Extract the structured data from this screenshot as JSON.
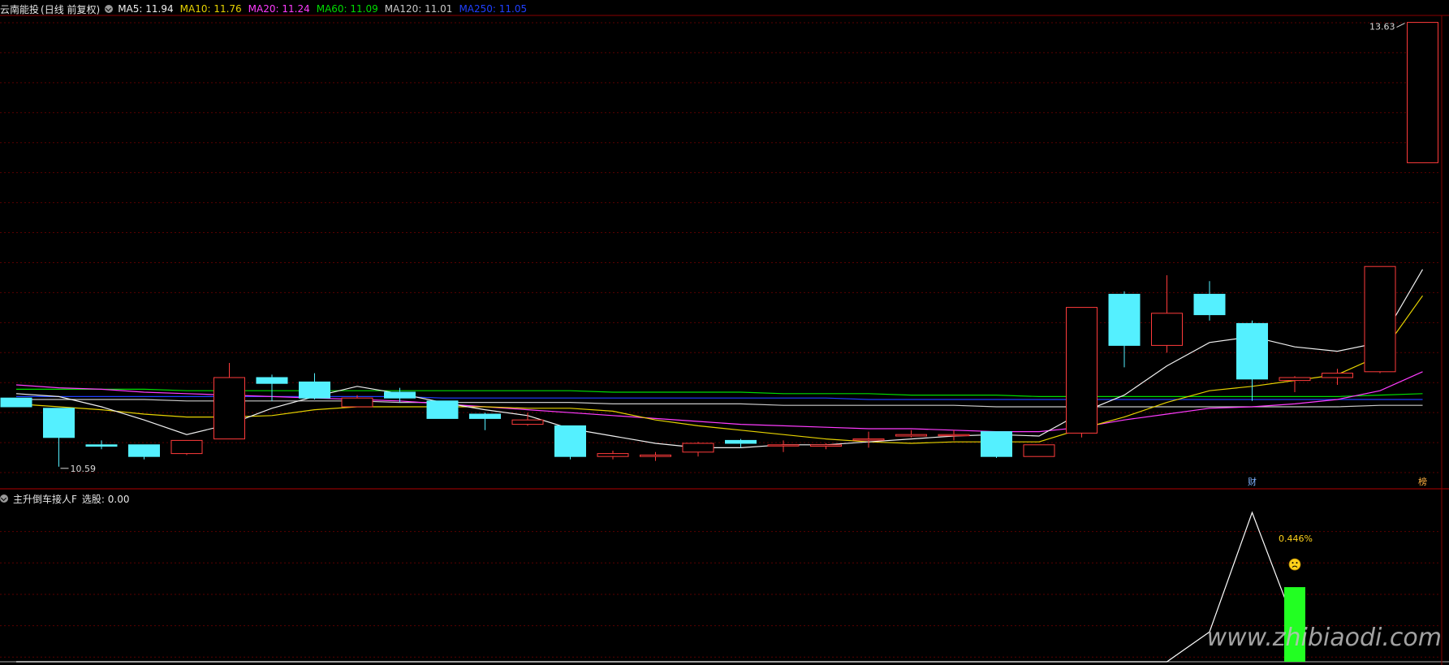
{
  "main_panel": {
    "stock_name": "云南能投",
    "mode_label": "(日线 前复权)",
    "indicators": [
      {
        "label": "MA5: 11.94",
        "color": "#f0f0f0"
      },
      {
        "label": "MA10: 11.76",
        "color": "#e6d200"
      },
      {
        "label": "MA20: 11.24",
        "color": "#ff3cff"
      },
      {
        "label": "MA60: 11.09",
        "color": "#00dc00"
      },
      {
        "label": "MA120: 11.01",
        "color": "#c8c8c8"
      },
      {
        "label": "MA250: 11.05",
        "color": "#2040ff"
      }
    ],
    "high_label": "13.63",
    "low_label": "10.59",
    "event_marker_1": "财",
    "event_marker_2": "榜"
  },
  "sub_panel": {
    "indicator_name": "主升倒车接人F",
    "value_label": "选股: 0.00",
    "percent_label": "0.446%",
    "emoji_icon": "sad-face-icon"
  },
  "watermark": "www.zhibiaodi.com",
  "colors": {
    "up": "#ff3b3b",
    "down": "#54f0ff",
    "grid": "#5a0000",
    "ma5": "#f0f0f0",
    "ma10": "#e6d200",
    "ma20": "#ff3cff",
    "ma60": "#00dc00",
    "ma120": "#c8c8c8",
    "ma250": "#2040ff",
    "signal_bar": "#22ff22"
  },
  "chart_data": {
    "type": "candlestick",
    "candles": [
      {
        "o": 11.06,
        "c": 11.0,
        "h": 11.06,
        "l": 11.0
      },
      {
        "o": 10.99,
        "c": 10.79,
        "h": 10.99,
        "l": 10.59
      },
      {
        "o": 10.74,
        "c": 10.73,
        "h": 10.77,
        "l": 10.71
      },
      {
        "o": 10.74,
        "c": 10.66,
        "h": 10.74,
        "l": 10.64
      },
      {
        "o": 10.68,
        "c": 10.77,
        "h": 10.77,
        "l": 10.67
      },
      {
        "o": 10.78,
        "c": 11.2,
        "h": 11.3,
        "l": 10.78
      },
      {
        "o": 11.2,
        "c": 11.16,
        "h": 11.22,
        "l": 11.04
      },
      {
        "o": 11.17,
        "c": 11.06,
        "h": 11.23,
        "l": 11.05
      },
      {
        "o": 11.0,
        "c": 11.06,
        "h": 11.08,
        "l": 11.0
      },
      {
        "o": 11.1,
        "c": 11.06,
        "h": 11.13,
        "l": 11.03
      },
      {
        "o": 11.04,
        "c": 10.92,
        "h": 11.04,
        "l": 10.92
      },
      {
        "o": 10.95,
        "c": 10.92,
        "h": 10.96,
        "l": 10.84
      },
      {
        "o": 10.88,
        "c": 10.91,
        "h": 10.96,
        "l": 10.87
      },
      {
        "o": 10.87,
        "c": 10.66,
        "h": 10.87,
        "l": 10.64
      },
      {
        "o": 10.66,
        "c": 10.68,
        "h": 10.7,
        "l": 10.64
      },
      {
        "o": 10.66,
        "c": 10.67,
        "h": 10.69,
        "l": 10.63
      },
      {
        "o": 10.69,
        "c": 10.75,
        "h": 10.76,
        "l": 10.66
      },
      {
        "o": 10.77,
        "c": 10.75,
        "h": 10.78,
        "l": 10.72
      },
      {
        "o": 10.74,
        "c": 10.74,
        "h": 10.77,
        "l": 10.69
      },
      {
        "o": 10.73,
        "c": 10.74,
        "h": 10.75,
        "l": 10.71
      },
      {
        "o": 10.78,
        "c": 10.78,
        "h": 10.83,
        "l": 10.72
      },
      {
        "o": 10.8,
        "c": 10.81,
        "h": 10.84,
        "l": 10.79
      },
      {
        "o": 10.81,
        "c": 10.81,
        "h": 10.84,
        "l": 10.77
      },
      {
        "o": 10.83,
        "c": 10.66,
        "h": 10.83,
        "l": 10.65
      },
      {
        "o": 10.66,
        "c": 10.74,
        "h": 10.74,
        "l": 10.66
      },
      {
        "o": 10.82,
        "c": 11.68,
        "h": 11.68,
        "l": 10.79
      },
      {
        "o": 11.77,
        "c": 11.42,
        "h": 11.79,
        "l": 11.27
      },
      {
        "o": 11.42,
        "c": 11.64,
        "h": 11.9,
        "l": 11.37
      },
      {
        "o": 11.77,
        "c": 11.63,
        "h": 11.86,
        "l": 11.59
      },
      {
        "o": 11.57,
        "c": 11.19,
        "h": 11.59,
        "l": 11.04
      },
      {
        "o": 11.18,
        "c": 11.2,
        "h": 11.21,
        "l": 11.1
      },
      {
        "o": 11.2,
        "c": 11.23,
        "h": 11.26,
        "l": 11.15
      },
      {
        "o": 11.24,
        "c": 11.96,
        "h": 11.96,
        "l": 11.23
      },
      {
        "o": 12.67,
        "c": 13.63,
        "h": 13.63,
        "l": 12.67
      }
    ],
    "ma5": [
      11.09,
      11.07,
      11.0,
      10.91,
      10.81,
      10.88,
      10.99,
      11.07,
      11.14,
      11.09,
      11.03,
      10.98,
      10.94,
      10.85,
      10.8,
      10.75,
      10.72,
      10.72,
      10.74,
      10.74,
      10.76,
      10.78,
      10.8,
      10.81,
      10.8,
      10.96,
      11.08,
      11.28,
      11.44,
      11.48,
      11.41,
      11.38,
      11.44,
      11.94
    ],
    "ma10": [
      11.02,
      11.0,
      10.98,
      10.95,
      10.93,
      10.93,
      10.94,
      10.98,
      11.0,
      11.0,
      11.0,
      11.0,
      10.99,
      10.99,
      10.97,
      10.91,
      10.87,
      10.84,
      10.81,
      10.78,
      10.76,
      10.75,
      10.76,
      10.76,
      10.76,
      10.85,
      10.93,
      11.03,
      11.11,
      11.14,
      11.18,
      11.22,
      11.35,
      11.76
    ],
    "ma20": [
      11.15,
      11.13,
      11.12,
      11.1,
      11.09,
      11.08,
      11.07,
      11.06,
      11.05,
      11.04,
      11.02,
      11.0,
      10.98,
      10.96,
      10.94,
      10.92,
      10.9,
      10.88,
      10.87,
      10.86,
      10.85,
      10.85,
      10.84,
      10.83,
      10.83,
      10.86,
      10.91,
      10.95,
      10.99,
      11.0,
      11.02,
      11.05,
      11.11,
      11.24
    ],
    "ma60": [
      11.12,
      11.12,
      11.12,
      11.12,
      11.11,
      11.11,
      11.11,
      11.11,
      11.11,
      11.11,
      11.11,
      11.11,
      11.11,
      11.11,
      11.1,
      11.1,
      11.1,
      11.1,
      11.09,
      11.09,
      11.09,
      11.08,
      11.08,
      11.08,
      11.07,
      11.07,
      11.07,
      11.07,
      11.07,
      11.07,
      11.07,
      11.07,
      11.08,
      11.09
    ],
    "ma120": [
      11.05,
      11.05,
      11.05,
      11.05,
      11.04,
      11.04,
      11.04,
      11.04,
      11.04,
      11.03,
      11.03,
      11.03,
      11.03,
      11.03,
      11.02,
      11.02,
      11.02,
      11.02,
      11.01,
      11.01,
      11.01,
      11.01,
      11.01,
      11.0,
      11.0,
      11.0,
      11.0,
      11.0,
      11.0,
      11.0,
      11.0,
      11.0,
      11.01,
      11.01
    ],
    "ma250": [
      11.07,
      11.07,
      11.07,
      11.07,
      11.07,
      11.07,
      11.07,
      11.07,
      11.07,
      11.07,
      11.06,
      11.06,
      11.06,
      11.06,
      11.06,
      11.06,
      11.06,
      11.06,
      11.06,
      11.06,
      11.05,
      11.05,
      11.05,
      11.05,
      11.05,
      11.05,
      11.05,
      11.05,
      11.05,
      11.05,
      11.05,
      11.05,
      11.05,
      11.05
    ],
    "ylim": [
      10.55,
      13.65
    ],
    "grid_lines": 15,
    "event_bars": [
      29,
      33
    ],
    "sub_indicator": {
      "zigzag": [
        {
          "bar": 0,
          "v": 0
        },
        {
          "bar": 27,
          "v": 0
        },
        {
          "bar": 28,
          "v": 0.2
        },
        {
          "bar": 29,
          "v": 1.0
        },
        {
          "bar": 30,
          "v": 0.25
        }
      ],
      "signal_bar_index": 30,
      "signal_value": 0.5,
      "ylim": [
        0,
        1.05
      ]
    }
  }
}
